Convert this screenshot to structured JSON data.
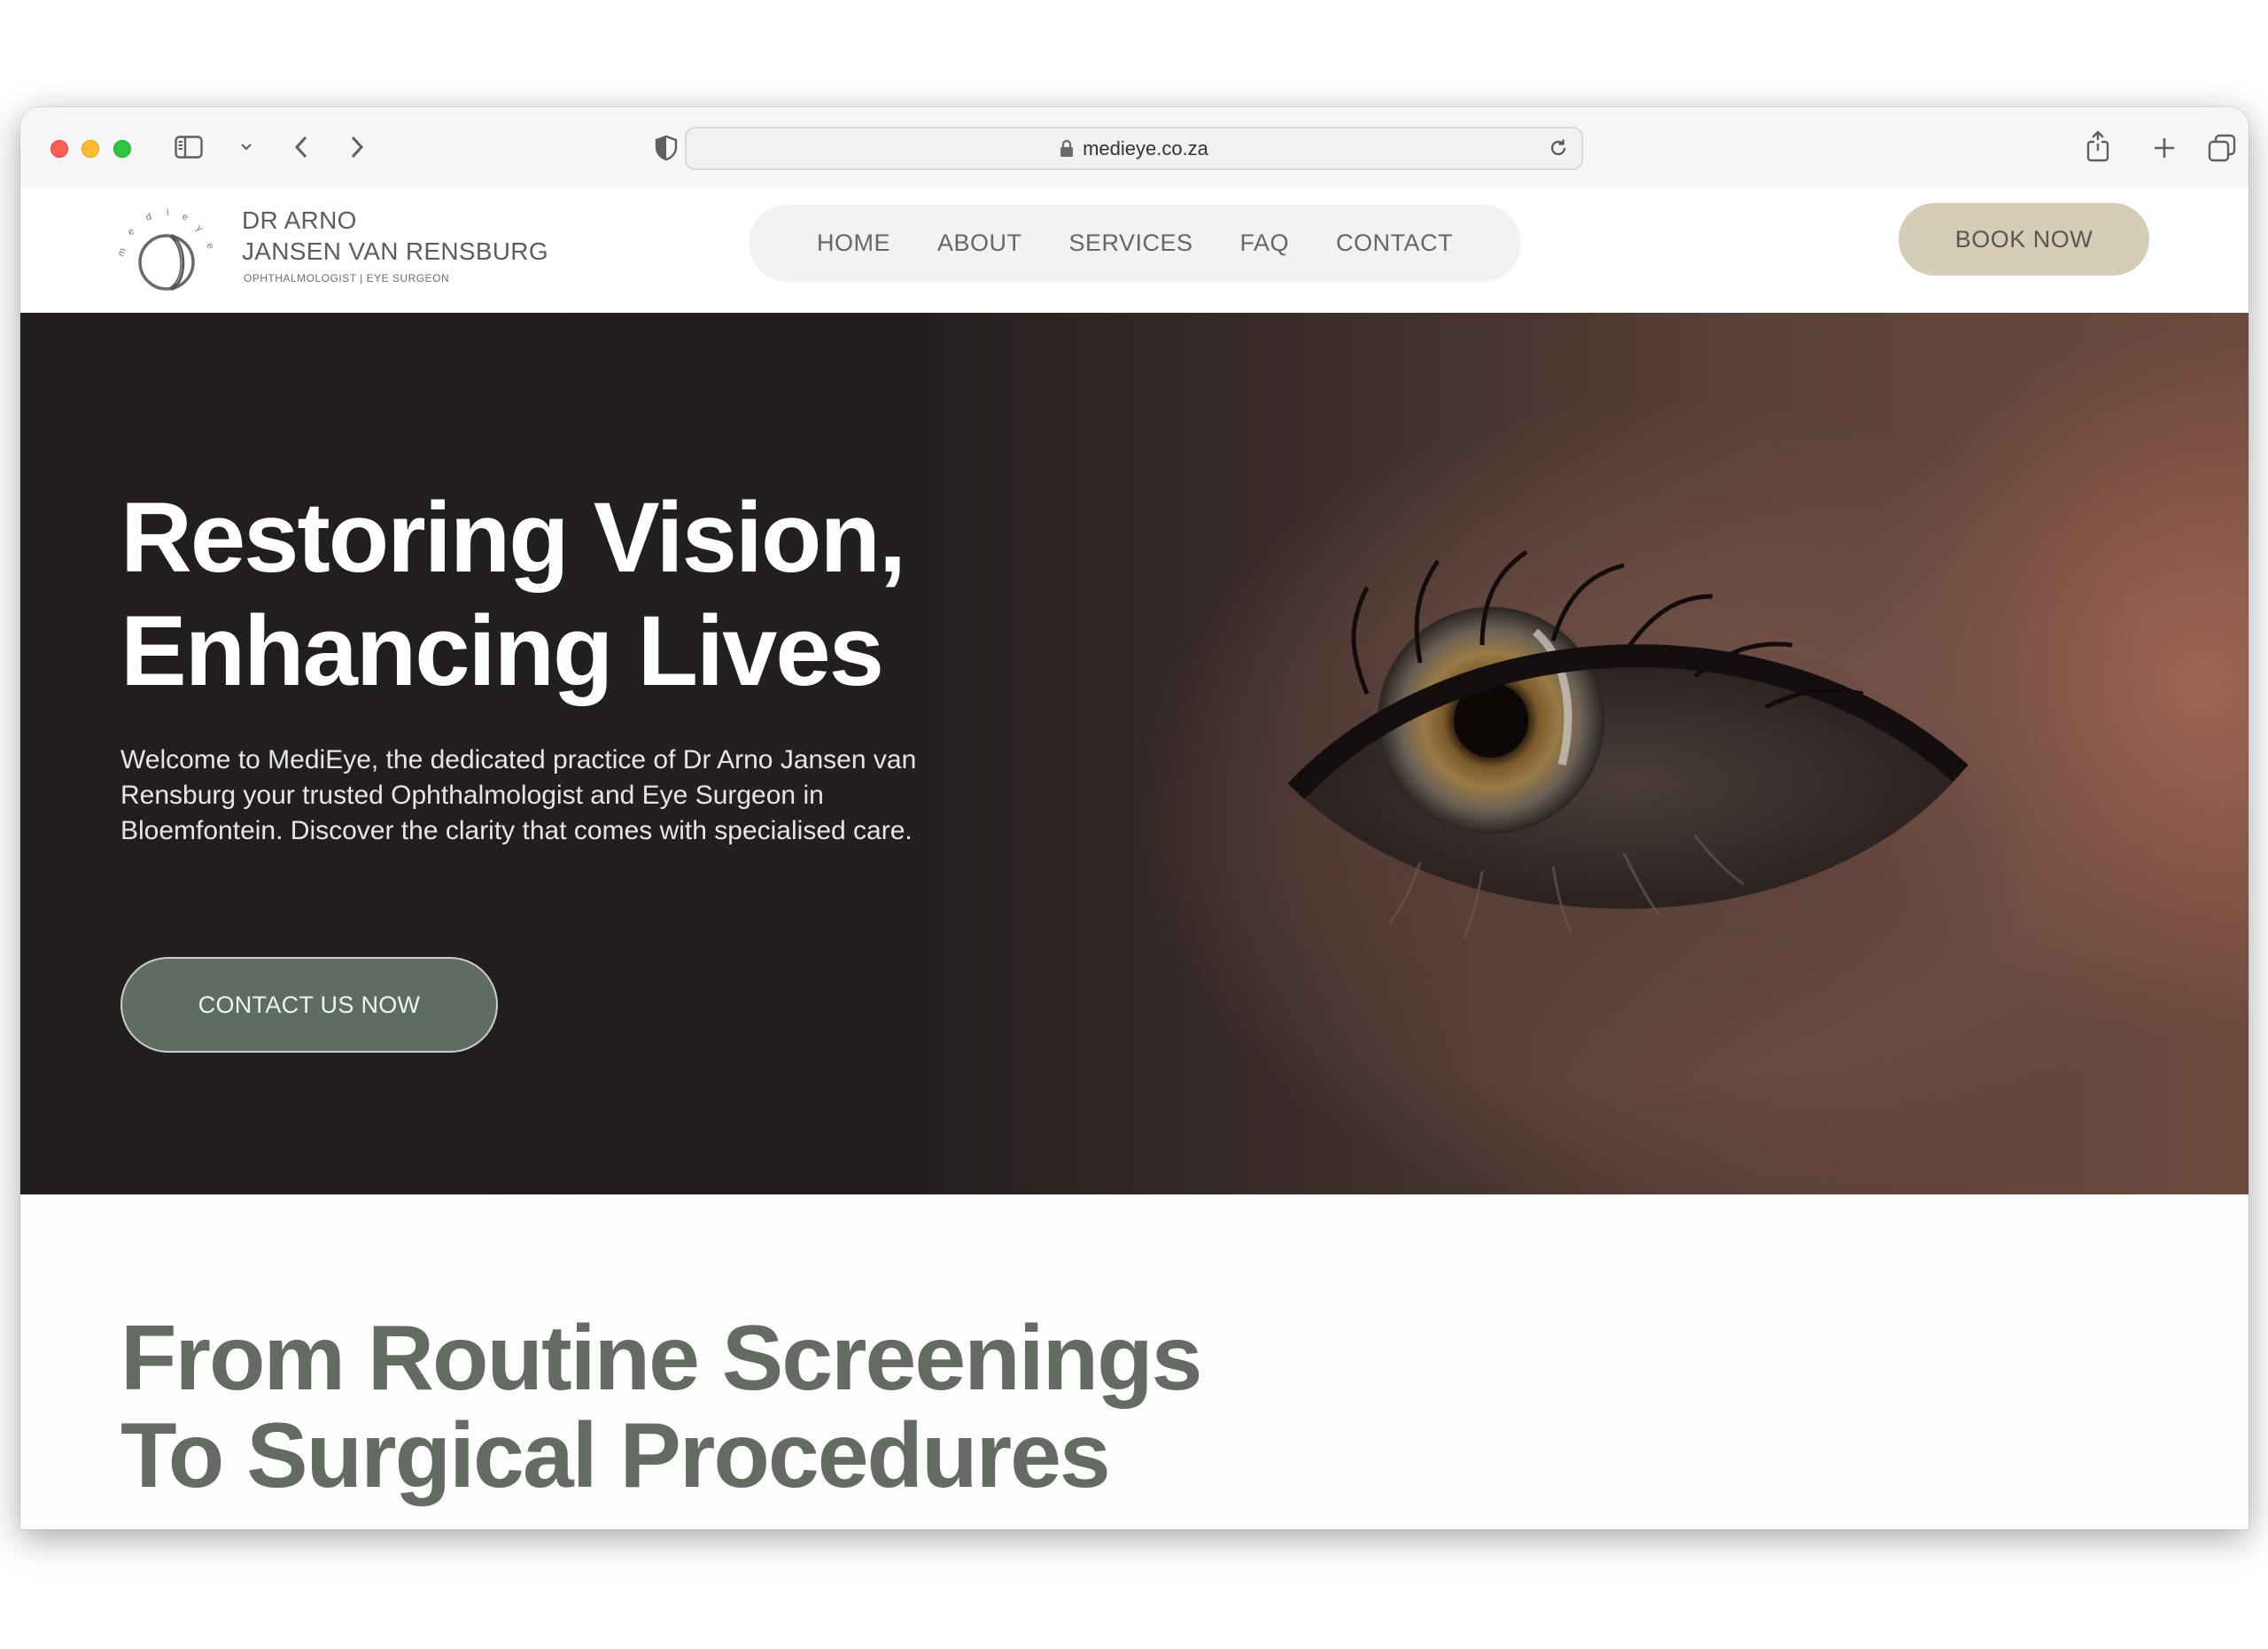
{
  "browser": {
    "url": "medieye.co.za"
  },
  "header": {
    "logo_line1": "DR ARNO",
    "logo_line2": "JANSEN VAN RENSBURG",
    "logo_sub": "OPHTHALMOLOGIST  |  EYE SURGEON",
    "logo_arc_text": "medieye",
    "nav": [
      "HOME",
      "ABOUT",
      "SERVICES",
      "FAQ",
      "CONTACT"
    ],
    "book_label": "BOOK NOW"
  },
  "hero": {
    "title_line1": "Restoring Vision,",
    "title_line2": "Enhancing Lives",
    "text": "Welcome to MediEye, the dedicated practice of Dr Arno Jansen van Rensburg your trusted Ophthalmologist and Eye Surgeon in Bloemfontein. Discover the clarity that comes with specialised care.",
    "cta_label": "CONTACT US NOW"
  },
  "section2": {
    "title_line1": "From Routine Screenings",
    "title_line2": "To Surgical Procedures"
  },
  "colors": {
    "book_button": "#d5cdb6",
    "cta_button": "#5f6c62",
    "section_title": "#646b63",
    "hero_dark": "#221d1d"
  },
  "icons": [
    "sidebar-icon",
    "chevron-down-icon",
    "back-icon",
    "forward-icon",
    "shield-icon",
    "lock-icon",
    "reload-icon",
    "share-icon",
    "new-tab-icon",
    "tabs-overview-icon"
  ]
}
